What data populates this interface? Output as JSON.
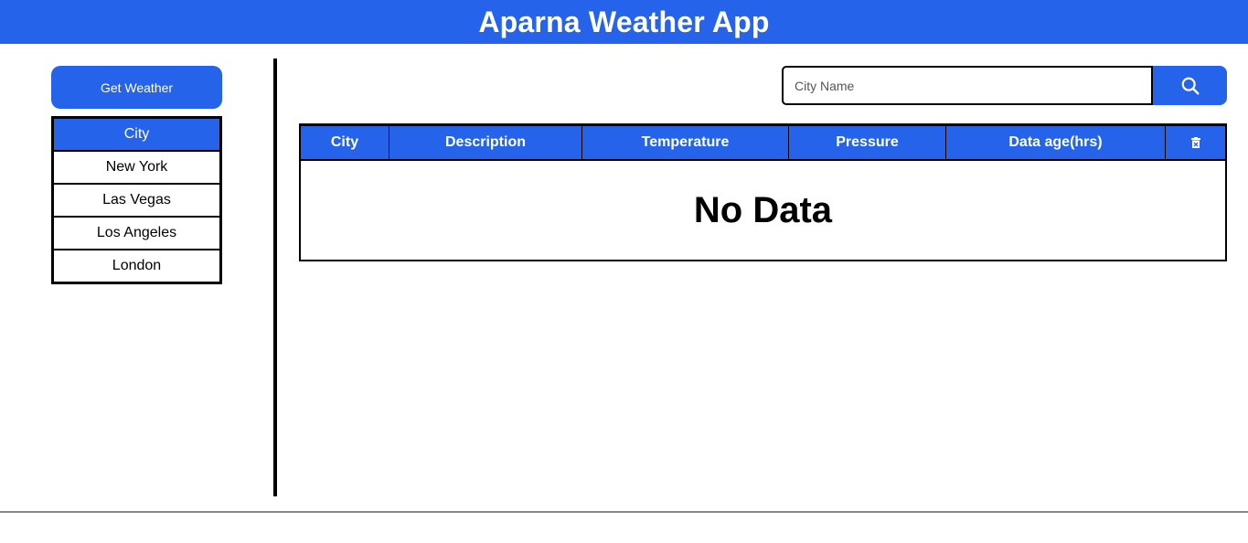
{
  "app": {
    "title": "Aparna Weather App"
  },
  "sidebar": {
    "get_weather_label": "Get Weather",
    "list_header": "City",
    "cities": [
      "New York",
      "Las Vegas",
      "Los Angeles",
      "London"
    ]
  },
  "search": {
    "placeholder": "City Name",
    "value": "",
    "button_icon": "search-icon"
  },
  "table": {
    "columns": [
      "City",
      "Description",
      "Temperature",
      "Pressure",
      "Data age(hrs)"
    ],
    "delete_column_icon": "trash-icon",
    "empty_text": "No Data"
  },
  "colors": {
    "accent": "#2563eb",
    "text": "#000000",
    "background": "#ffffff"
  }
}
